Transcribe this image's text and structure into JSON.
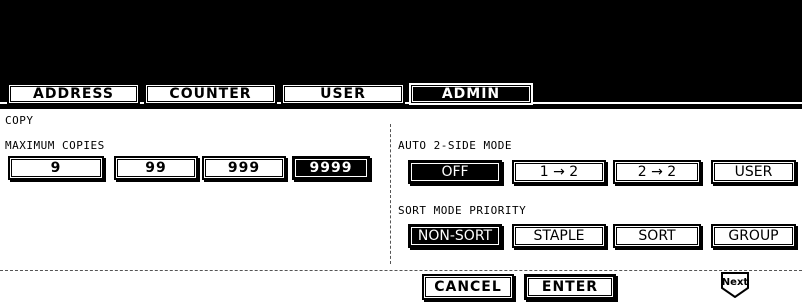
{
  "tabs": [
    {
      "label": "ADDRESS",
      "active": false
    },
    {
      "label": "COUNTER",
      "active": false
    },
    {
      "label": "USER",
      "active": false
    },
    {
      "label": "ADMIN",
      "active": true
    }
  ],
  "section_title": "COPY",
  "max_copies": {
    "label": "MAXIMUM COPIES",
    "options": [
      "9",
      "99",
      "999",
      "9999"
    ],
    "selected": "9999"
  },
  "auto_2side": {
    "label": "AUTO 2-SIDE MODE",
    "options": [
      "OFF",
      "1 → 2",
      "2 → 2",
      "USER"
    ],
    "selected": "OFF"
  },
  "sort_priority": {
    "label": "SORT MODE PRIORITY",
    "options": [
      "NON-SORT",
      "STAPLE",
      "SORT",
      "GROUP"
    ],
    "selected": "NON-SORT"
  },
  "footer": {
    "cancel_label": "CANCEL",
    "enter_label": "ENTER",
    "next_label": "Next"
  }
}
